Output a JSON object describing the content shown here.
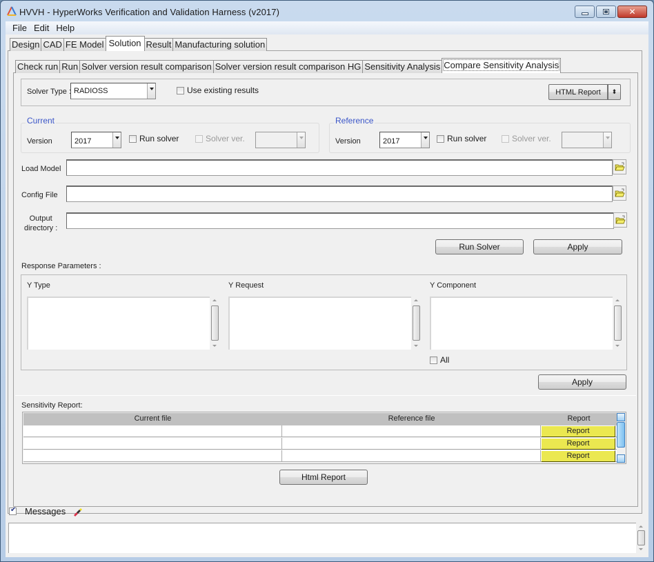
{
  "window": {
    "title": "HVVH - HyperWorks Verification and Validation Harness (v2017)",
    "controls": [
      "minimize",
      "maximize",
      "close"
    ]
  },
  "menubar": {
    "items": [
      "File",
      "Edit",
      "Help"
    ]
  },
  "main_tabs": {
    "items": [
      "Design",
      "CAD",
      "FE Model",
      "Solution",
      "Result",
      "Manufacturing solution"
    ],
    "active": "Solution"
  },
  "sub_tabs": {
    "items": [
      "Check run",
      "Run",
      "Solver version result comparison",
      "Solver version result comparison HG",
      "Sensitivity Analysis",
      "Compare Sensitivity Analysis"
    ],
    "active": "Compare Sensitivity Analysis"
  },
  "solver": {
    "label": "Solver Type :",
    "value": "RADIOSS",
    "use_existing_label": "Use existing results",
    "use_existing_checked": false,
    "report_format": "HTML Report"
  },
  "current": {
    "title": "Current",
    "version_label": "Version",
    "version_value": "2017",
    "run_solver_label": "Run solver",
    "run_solver_checked": false,
    "solver_ver_label": "Solver ver.",
    "solver_ver_value": ""
  },
  "reference": {
    "title": "Reference",
    "version_label": "Version",
    "version_value": "2017",
    "run_solver_label": "Run solver",
    "run_solver_checked": false,
    "solver_ver_label": "Solver ver.",
    "solver_ver_value": ""
  },
  "files": {
    "load_model_label": "Load Model",
    "load_model_value": "",
    "config_file_label": "Config File",
    "config_file_value": "",
    "output_dir_label_1": "Output",
    "output_dir_label_2": "directory :",
    "output_dir_value": ""
  },
  "actions": {
    "run_solver": "Run Solver",
    "apply": "Apply"
  },
  "response": {
    "title": "Response Parameters :",
    "y_type_label": "Y Type",
    "y_request_label": "Y Request",
    "y_component_label": "Y Component",
    "all_label": "All",
    "all_checked": false,
    "apply": "Apply"
  },
  "sensitivity_report": {
    "title": "Sensitivity Report:",
    "columns": [
      "Current file",
      "Reference file",
      "Report"
    ],
    "rows": [
      {
        "current": "",
        "reference": "",
        "report": "Report"
      },
      {
        "current": "",
        "reference": "",
        "report": "Report"
      },
      {
        "current": "",
        "reference": "",
        "report": "Report"
      }
    ],
    "html_report_button": "Html Report"
  },
  "messages": {
    "label": "Messages",
    "checked": true,
    "content": ""
  },
  "colors": {
    "group_title": "#3a55c8",
    "report_cell": "#ebe850",
    "table_header": "#c0c0c0"
  }
}
